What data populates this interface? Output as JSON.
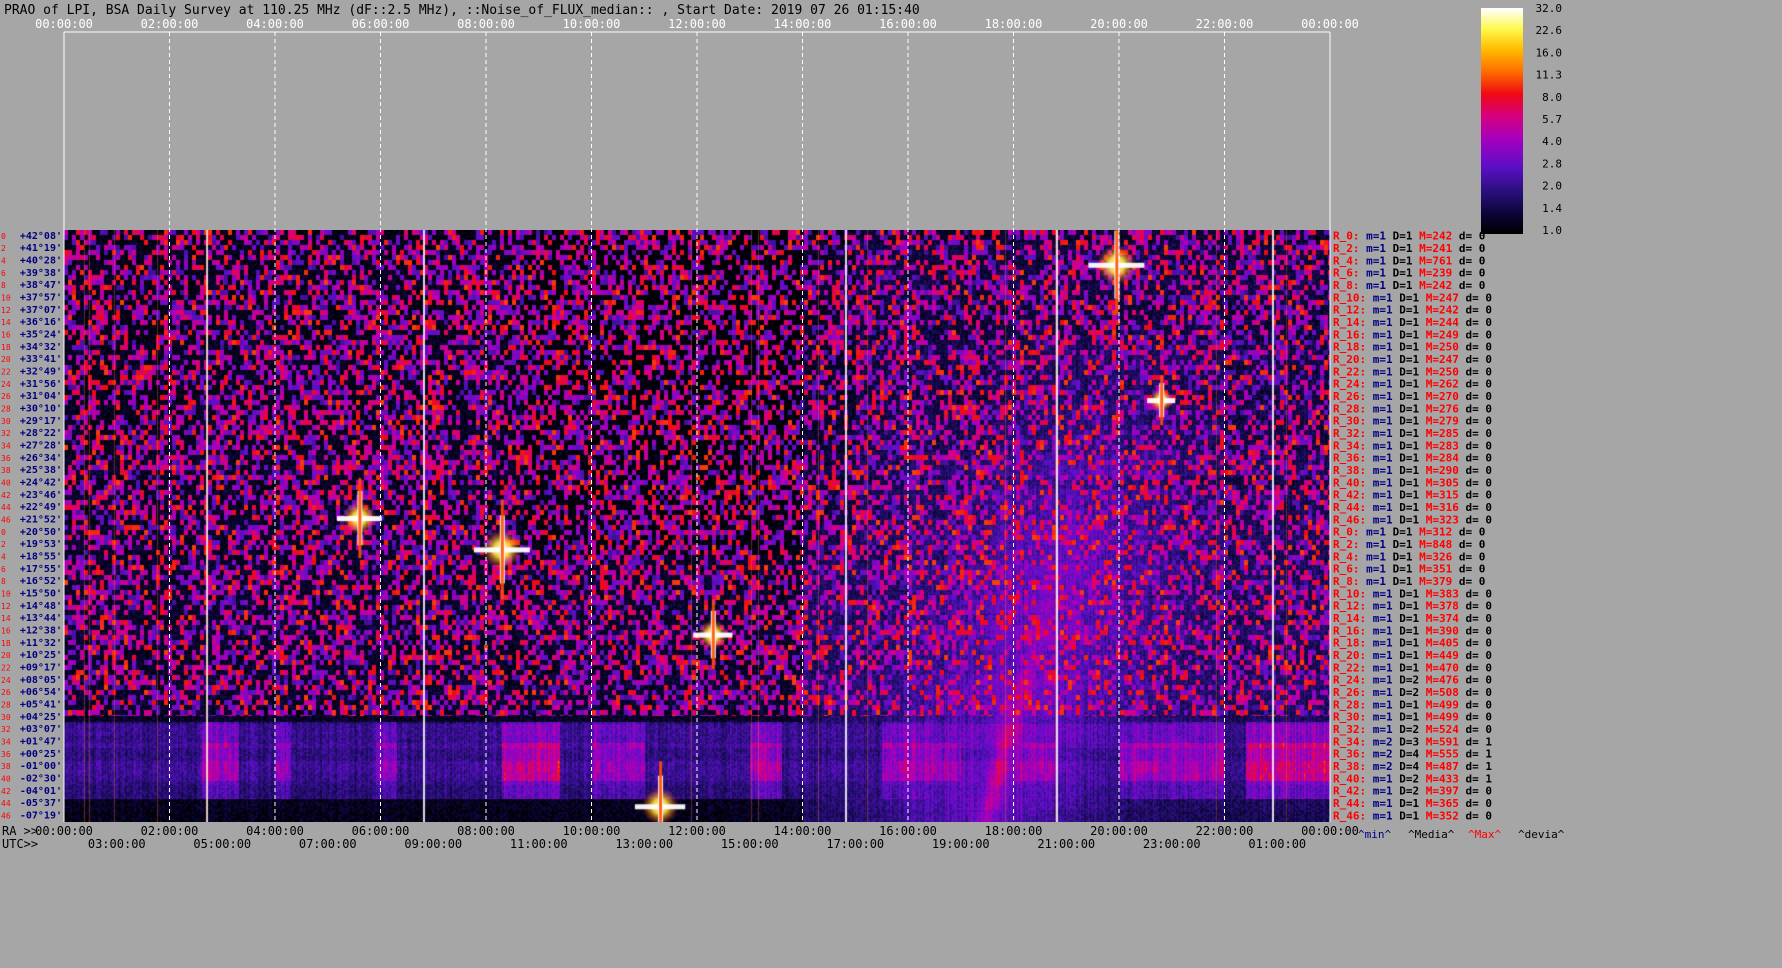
{
  "chart_data": {
    "type": "heatmap",
    "title": "PRAO of LPI, BSA Daily Survey at 110.25 MHz (dF::2.5 MHz), ::Noise_of_FLUX_median:: , Start Date: 2019 07 26 01:15:40",
    "x_top_ticks": [
      "00:00:00",
      "02:00:00",
      "04:00:00",
      "06:00:00",
      "08:00:00",
      "10:00:00",
      "12:00:00",
      "14:00:00",
      "16:00:00",
      "18:00:00",
      "20:00:00",
      "22:00:00",
      "00:00:00"
    ],
    "x_ra_ticks": [
      "00:00:00",
      "02:00:00",
      "04:00:00",
      "06:00:00",
      "08:00:00",
      "10:00:00",
      "12:00:00",
      "14:00:00",
      "16:00:00",
      "18:00:00",
      "20:00:00",
      "22:00:00",
      "00:00:00"
    ],
    "x_utc_ticks": [
      "03:00:00",
      "05:00:00",
      "07:00:00",
      "09:00:00",
      "11:00:00",
      "13:00:00",
      "15:00:00",
      "17:00:00",
      "19:00:00",
      "21:00:00",
      "23:00:00",
      "01:00:00"
    ],
    "ra_label": "RA >>",
    "utc_label": "UTC>>",
    "y_dec_ticks": [
      "+42°08'",
      "+41°19'",
      "+40°28'",
      "+39°38'",
      "+38°47'",
      "+37°57'",
      "+37°07'",
      "+36°16'",
      "+35°24'",
      "+34°32'",
      "+33°41'",
      "+32°49'",
      "+31°56'",
      "+31°04'",
      "+30°10'",
      "+29°17'",
      "+28°22'",
      "+27°28'",
      "+26°34'",
      "+25°38'",
      "+24°42'",
      "+23°46'",
      "+22°49'",
      "+21°52'",
      "+20°50'",
      "+19°53'",
      "+18°55'",
      "+17°55'",
      "+16°52'",
      "+15°50'",
      "+14°48'",
      "+13°44'",
      "+12°38'",
      "+11°32'",
      "+10°25'",
      "+09°17'",
      "+08°05'",
      "+06°54'",
      "+05°41'",
      "+04°25'",
      "+03°07'",
      "+01°47'",
      "+00°25'",
      "-01°00'",
      "-02°30'",
      "-04°01'",
      "-05°37'",
      "-07°19'"
    ],
    "colorbar": {
      "ticks": [
        "32.0",
        "22.6",
        "16.0",
        "11.3",
        "8.0",
        "5.7",
        "4.0",
        "2.8",
        "2.0",
        "1.4",
        "1.0"
      ],
      "colors": [
        "#ffffff",
        "#ffff60",
        "#ffc000",
        "#ff6000",
        "#e80000",
        "#c0008a",
        "#a000c0",
        "#7010e0",
        "#4a10b0",
        "#1a0860",
        "#000000"
      ]
    },
    "hotspots": [
      {
        "ra_h": 19.95,
        "dec": 40.2,
        "strength": 1.0
      },
      {
        "ra_h": 8.3,
        "dec": 19.5,
        "strength": 1.0
      },
      {
        "ra_h": 5.6,
        "dec": 22.0,
        "strength": 0.8
      },
      {
        "ra_h": 12.3,
        "dec": 12.3,
        "strength": 0.7
      },
      {
        "ra_h": 20.8,
        "dec": 30.8,
        "strength": 0.5
      },
      {
        "ra_h": 11.3,
        "dec": -6.0,
        "strength": 0.9
      }
    ],
    "bright_bands": [
      {
        "ra_start": 2.6,
        "ra_end": 3.3,
        "level": 0.75
      },
      {
        "ra_start": 4.0,
        "ra_end": 4.3,
        "level": 0.6
      },
      {
        "ra_start": 5.9,
        "ra_end": 6.3,
        "level": 0.6
      },
      {
        "ra_start": 8.3,
        "ra_end": 9.4,
        "level": 0.95
      },
      {
        "ra_start": 10.0,
        "ra_end": 11.0,
        "level": 0.7
      },
      {
        "ra_start": 13.0,
        "ra_end": 13.6,
        "level": 0.8
      },
      {
        "ra_start": 15.5,
        "ra_end": 17.0,
        "level": 0.75
      },
      {
        "ra_start": 18.0,
        "ra_end": 18.8,
        "level": 0.75
      },
      {
        "ra_start": 20.0,
        "ra_end": 22.0,
        "level": 0.75
      },
      {
        "ra_start": 22.4,
        "ra_end": 24.0,
        "level": 1.0
      }
    ],
    "rows": [
      {
        "r": "R_0:",
        "m": "1",
        "D": "1",
        "M": "242",
        "d": "0"
      },
      {
        "r": "R_2:",
        "m": "1",
        "D": "1",
        "M": "241",
        "d": "0"
      },
      {
        "r": "R_4:",
        "m": "1",
        "D": "1",
        "M": "761",
        "d": "0"
      },
      {
        "r": "R_6:",
        "m": "1",
        "D": "1",
        "M": "239",
        "d": "0"
      },
      {
        "r": "R_8:",
        "m": "1",
        "D": "1",
        "M": "242",
        "d": "0"
      },
      {
        "r": "R_10:",
        "m": "1",
        "D": "1",
        "M": "247",
        "d": "0"
      },
      {
        "r": "R_12:",
        "m": "1",
        "D": "1",
        "M": "242",
        "d": "0"
      },
      {
        "r": "R_14:",
        "m": "1",
        "D": "1",
        "M": "244",
        "d": "0"
      },
      {
        "r": "R_16:",
        "m": "1",
        "D": "1",
        "M": "249",
        "d": "0"
      },
      {
        "r": "R_18:",
        "m": "1",
        "D": "1",
        "M": "250",
        "d": "0"
      },
      {
        "r": "R_20:",
        "m": "1",
        "D": "1",
        "M": "247",
        "d": "0"
      },
      {
        "r": "R_22:",
        "m": "1",
        "D": "1",
        "M": "250",
        "d": "0"
      },
      {
        "r": "R_24:",
        "m": "1",
        "D": "1",
        "M": "262",
        "d": "0"
      },
      {
        "r": "R_26:",
        "m": "1",
        "D": "1",
        "M": "270",
        "d": "0"
      },
      {
        "r": "R_28:",
        "m": "1",
        "D": "1",
        "M": "276",
        "d": "0"
      },
      {
        "r": "R_30:",
        "m": "1",
        "D": "1",
        "M": "279",
        "d": "0"
      },
      {
        "r": "R_32:",
        "m": "1",
        "D": "1",
        "M": "285",
        "d": "0"
      },
      {
        "r": "R_34:",
        "m": "1",
        "D": "1",
        "M": "283",
        "d": "0"
      },
      {
        "r": "R_36:",
        "m": "1",
        "D": "1",
        "M": "284",
        "d": "0"
      },
      {
        "r": "R_38:",
        "m": "1",
        "D": "1",
        "M": "290",
        "d": "0"
      },
      {
        "r": "R_40:",
        "m": "1",
        "D": "1",
        "M": "305",
        "d": "0"
      },
      {
        "r": "R_42:",
        "m": "1",
        "D": "1",
        "M": "315",
        "d": "0"
      },
      {
        "r": "R_44:",
        "m": "1",
        "D": "1",
        "M": "316",
        "d": "0"
      },
      {
        "r": "R_46:",
        "m": "1",
        "D": "1",
        "M": "323",
        "d": "0"
      },
      {
        "r": "R_0:",
        "m": "1",
        "D": "1",
        "M": "312",
        "d": "0"
      },
      {
        "r": "R_2:",
        "m": "1",
        "D": "1",
        "M": "848",
        "d": "0"
      },
      {
        "r": "R_4:",
        "m": "1",
        "D": "1",
        "M": "326",
        "d": "0"
      },
      {
        "r": "R_6:",
        "m": "1",
        "D": "1",
        "M": "351",
        "d": "0"
      },
      {
        "r": "R_8:",
        "m": "1",
        "D": "1",
        "M": "379",
        "d": "0"
      },
      {
        "r": "R_10:",
        "m": "1",
        "D": "1",
        "M": "383",
        "d": "0"
      },
      {
        "r": "R_12:",
        "m": "1",
        "D": "1",
        "M": "378",
        "d": "0"
      },
      {
        "r": "R_14:",
        "m": "1",
        "D": "1",
        "M": "374",
        "d": "0"
      },
      {
        "r": "R_16:",
        "m": "1",
        "D": "1",
        "M": "390",
        "d": "0"
      },
      {
        "r": "R_18:",
        "m": "1",
        "D": "1",
        "M": "405",
        "d": "0"
      },
      {
        "r": "R_20:",
        "m": "1",
        "D": "1",
        "M": "449",
        "d": "0"
      },
      {
        "r": "R_22:",
        "m": "1",
        "D": "1",
        "M": "470",
        "d": "0"
      },
      {
        "r": "R_24:",
        "m": "1",
        "D": "2",
        "M": "476",
        "d": "0"
      },
      {
        "r": "R_26:",
        "m": "1",
        "D": "2",
        "M": "508",
        "d": "0"
      },
      {
        "r": "R_28:",
        "m": "1",
        "D": "1",
        "M": "499",
        "d": "0"
      },
      {
        "r": "R_30:",
        "m": "1",
        "D": "1",
        "M": "499",
        "d": "0"
      },
      {
        "r": "R_32:",
        "m": "1",
        "D": "2",
        "M": "524",
        "d": "0"
      },
      {
        "r": "R_34:",
        "m": "2",
        "D": "3",
        "M": "591",
        "d": "1"
      },
      {
        "r": "R_36:",
        "m": "2",
        "D": "4",
        "M": "555",
        "d": "1"
      },
      {
        "r": "R_38:",
        "m": "2",
        "D": "4",
        "M": "487",
        "d": "1"
      },
      {
        "r": "R_40:",
        "m": "1",
        "D": "2",
        "M": "433",
        "d": "1"
      },
      {
        "r": "R_42:",
        "m": "1",
        "D": "2",
        "M": "397",
        "d": "0"
      },
      {
        "r": "R_44:",
        "m": "1",
        "D": "1",
        "M": "365",
        "d": "0"
      },
      {
        "r": "R_46:",
        "m": "1",
        "D": "1",
        "M": "352",
        "d": "0"
      }
    ],
    "row_numbers": [
      "0",
      "2",
      "4",
      "6",
      "8",
      "10",
      "12",
      "14",
      "16",
      "18",
      "20",
      "22",
      "24",
      "26",
      "28",
      "30",
      "32",
      "34",
      "36",
      "38",
      "40",
      "42",
      "44",
      "46",
      "0",
      "2",
      "4",
      "6",
      "8",
      "10",
      "12",
      "14",
      "16",
      "18",
      "20",
      "22",
      "24",
      "26",
      "28",
      "30",
      "32",
      "34",
      "36",
      "38",
      "40",
      "42",
      "44",
      "46"
    ],
    "legend": {
      "min": "^min^",
      "media": "^Media^",
      "max": "^Max^",
      "devia": "^devia^"
    },
    "colors": {
      "background": "#a6a6a6",
      "row_label_red": "#ff0000",
      "dec_label": "#000080",
      "min_color": "#000080",
      "max_color": "#ff0000"
    }
  }
}
